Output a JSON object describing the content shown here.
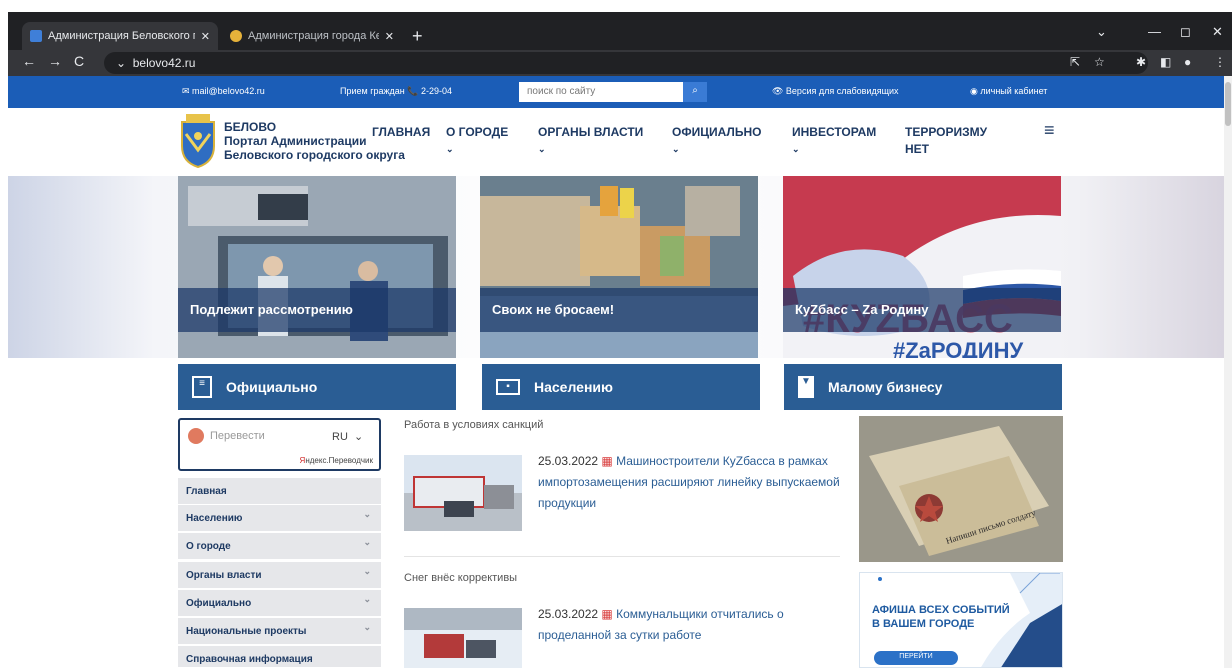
{
  "browser": {
    "tabs": [
      {
        "title": "Администрация Беловского гор",
        "close": "✕"
      },
      {
        "title": "Администрация города Кемерс",
        "close": "✕"
      }
    ],
    "new_tab": "+",
    "url": "belovo42.ru",
    "window_controls": [
      "⌄",
      "—",
      "◻",
      "✕"
    ]
  },
  "topbar": {
    "email": "✉ mail@belovo42.ru",
    "reception": "Прием граждан 📞 2-29-04",
    "search_placeholder": "поиск по сайту",
    "accessibility": "👁 Версия для слабовидящих",
    "cabinet": "◉ личный кабинет"
  },
  "brand": {
    "line1": "БЕЛОВО",
    "line2": "Портал Администрации",
    "line3": "Беловского городского округа"
  },
  "menu": [
    {
      "label": "ГЛАВНАЯ",
      "chev": ""
    },
    {
      "label": "О ГОРОДЕ",
      "chev": "⌄"
    },
    {
      "label": "ОРГАНЫ ВЛАСТИ",
      "chev": "⌄"
    },
    {
      "label": "ОФИЦИАЛЬНО",
      "chev": "⌄"
    },
    {
      "label": "ИНВЕСТОРАМ",
      "chev": "⌄"
    },
    {
      "label": "ТЕРРОРИЗМУ",
      "label2": "НЕТ"
    }
  ],
  "hero": [
    {
      "caption": "Подлежит рассмотрению"
    },
    {
      "caption": "Своих не бросаем!"
    },
    {
      "caption": "КуZбасс – Za Родину",
      "overlay_big": "#КУZБАСС",
      "overlay_small": "#ZаРОДИНУ"
    }
  ],
  "sections": [
    "Официально",
    "Населению",
    "Малому бизнесу"
  ],
  "translate": {
    "placeholder": "Перевести",
    "lang": "RU",
    "provider_y": "Я",
    "provider_rest": "ндекс.Переводчик"
  },
  "sidebar": [
    {
      "label": "Главная",
      "chev": ""
    },
    {
      "label": "Населению",
      "chev": "⌄"
    },
    {
      "label": "О городе",
      "chev": "⌄"
    },
    {
      "label": "Органы власти",
      "chev": "⌄"
    },
    {
      "label": "Официально",
      "chev": "⌄"
    },
    {
      "label": "Национальные проекты",
      "chev": "⌄"
    },
    {
      "label": "Справочная информация",
      "chev": ""
    }
  ],
  "news": [
    {
      "category": "Работа в условиях санкций",
      "date": "25.03.2022",
      "title": "Машиностроители КуZбасса в рамках импортозамещения расширяют линейку выпускаемой продукции"
    },
    {
      "category": "Снег внёс коррективы",
      "date": "25.03.2022",
      "title": "Коммунальщики отчитались о проделанной за сутки работе"
    }
  ],
  "banner_afisha": {
    "line1": "АФИША ВСЕХ СОБЫТИЙ",
    "line2": "В ВАШЕМ ГОРОДЕ",
    "button": "ПЕРЕЙТИ"
  },
  "banner_letter": {
    "inscription": "Напиши письмо солдату"
  }
}
